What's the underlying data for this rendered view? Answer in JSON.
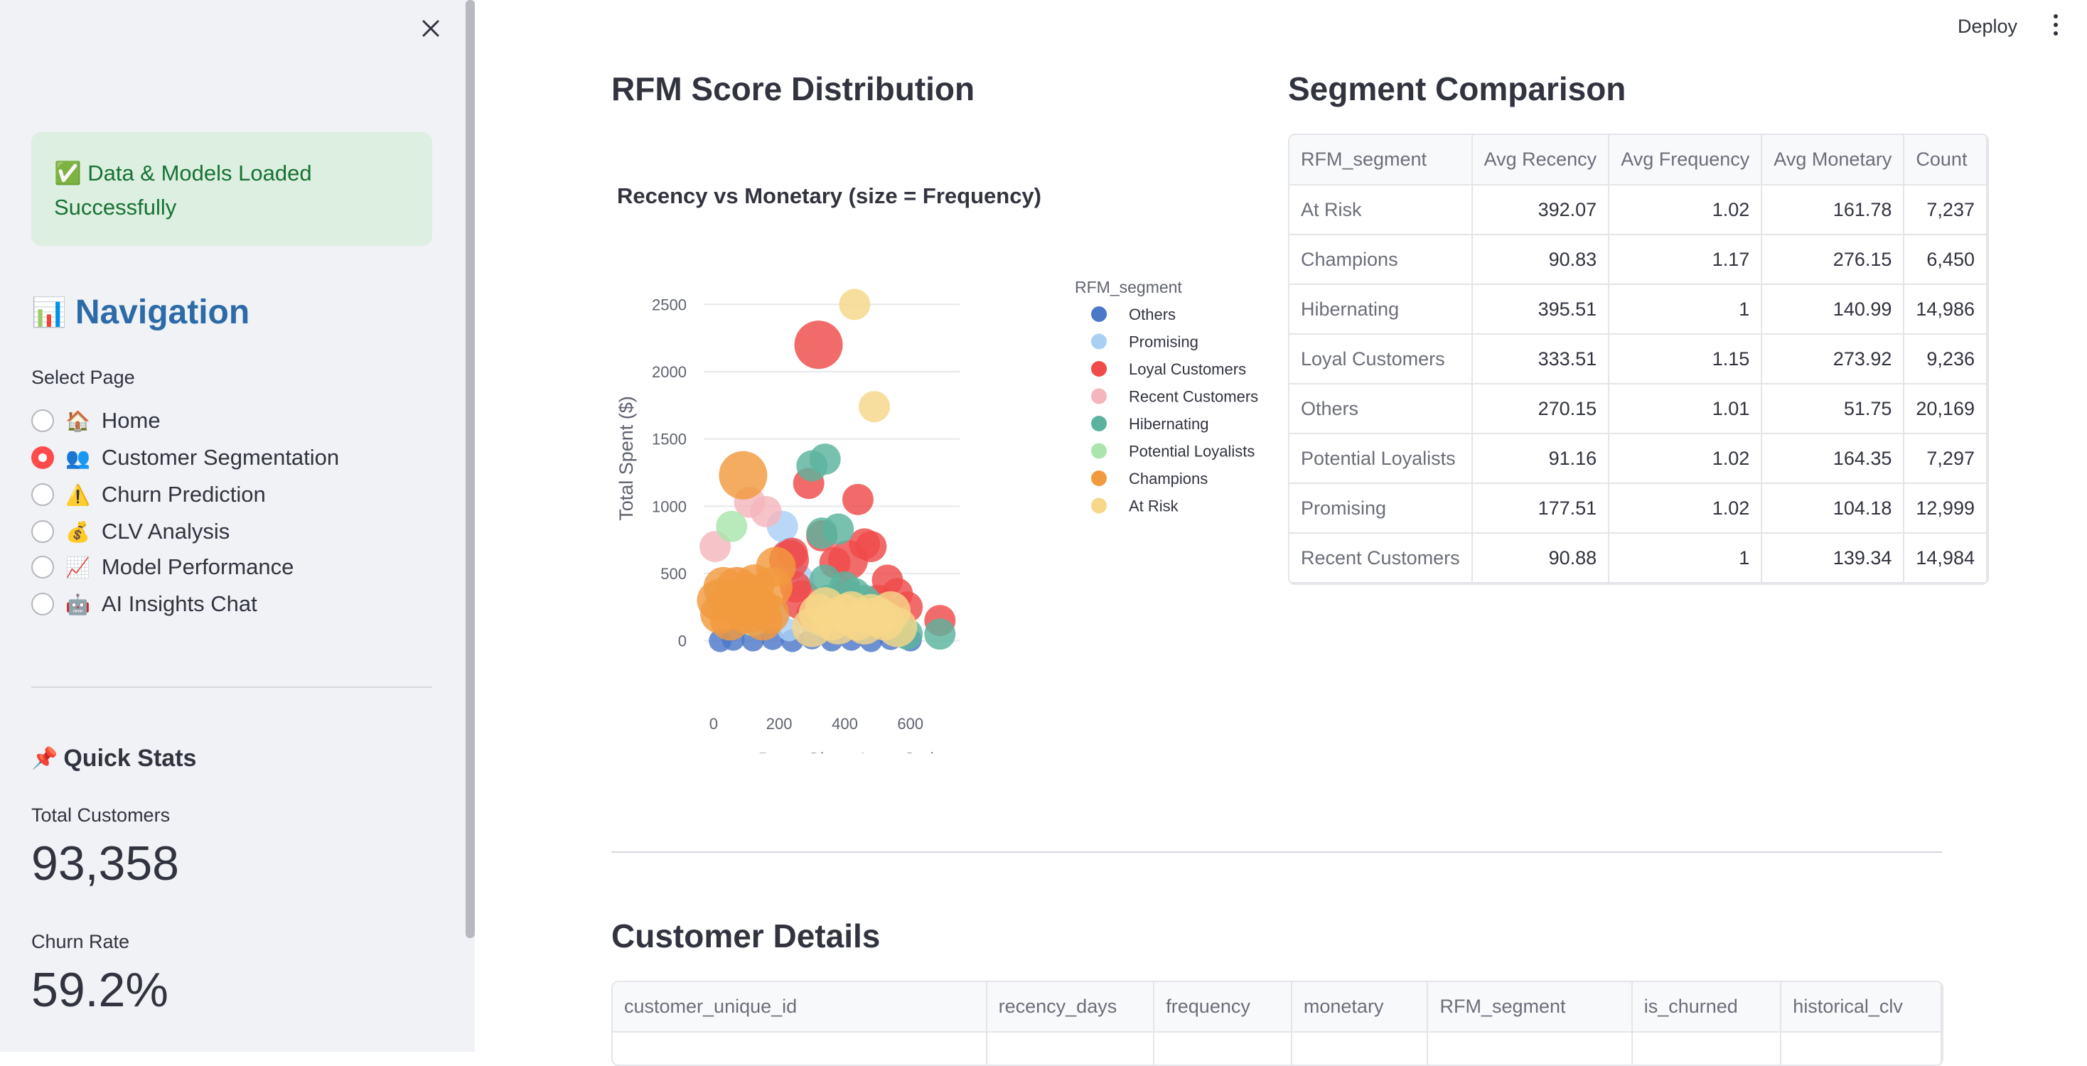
{
  "sidebar": {
    "alert_text": "✅ Data & Models Loaded Successfully",
    "nav_title": "Navigation",
    "select_label": "Select Page",
    "pages": [
      {
        "icon": "🏠",
        "label": "Home",
        "selected": false
      },
      {
        "icon": "👥",
        "label": "Customer Segmentation",
        "selected": true
      },
      {
        "icon": "⚠️",
        "label": "Churn Prediction",
        "selected": false
      },
      {
        "icon": "💰",
        "label": "CLV Analysis",
        "selected": false
      },
      {
        "icon": "📈",
        "label": "Model Performance",
        "selected": false
      },
      {
        "icon": "🤖",
        "label": "AI Insights Chat",
        "selected": false
      }
    ],
    "quick_stats_title": "Quick Stats",
    "metrics": [
      {
        "label": "Total Customers",
        "value": "93,358"
      },
      {
        "label": "Churn Rate",
        "value": "59.2%"
      }
    ]
  },
  "header": {
    "deploy_label": "Deploy"
  },
  "main": {
    "rfm_title": "RFM Score Distribution",
    "segment_title": "Segment Comparison",
    "details_title": "Customer Details"
  },
  "segment_table": {
    "columns": [
      "RFM_segment",
      "Avg Recency",
      "Avg Frequency",
      "Avg Monetary",
      "Count"
    ],
    "rows": [
      [
        "At Risk",
        "392.07",
        "1.02",
        "161.78",
        "7,237"
      ],
      [
        "Champions",
        "90.83",
        "1.17",
        "276.15",
        "6,450"
      ],
      [
        "Hibernating",
        "395.51",
        "1",
        "140.99",
        "14,986"
      ],
      [
        "Loyal Customers",
        "333.51",
        "1.15",
        "273.92",
        "9,236"
      ],
      [
        "Others",
        "270.15",
        "1.01",
        "51.75",
        "20,169"
      ],
      [
        "Potential Loyalists",
        "91.16",
        "1.02",
        "164.35",
        "7,297"
      ],
      [
        "Promising",
        "177.51",
        "1.02",
        "104.18",
        "12,999"
      ],
      [
        "Recent Customers",
        "90.88",
        "1",
        "139.34",
        "14,984"
      ]
    ]
  },
  "details_table": {
    "columns": [
      "customer_unique_id",
      "recency_days",
      "frequency",
      "monetary",
      "RFM_segment",
      "is_churned",
      "historical_clv"
    ]
  },
  "chart_data": {
    "type": "scatter",
    "title": "Recency vs Monetary (size = Frequency)",
    "xlabel": "Days Since Last Order",
    "ylabel": "Total Spent ($)",
    "legend_title": "RFM_segment",
    "legend_position": "right",
    "xlim": [
      -30,
      750
    ],
    "ylim": [
      -150,
      2650
    ],
    "xticks": [
      0,
      200,
      400,
      600
    ],
    "yticks": [
      0,
      500,
      1000,
      1500,
      2000,
      2500
    ],
    "series": [
      {
        "name": "Others",
        "color": "#4c78c8",
        "points": [
          [
            20,
            0,
            1
          ],
          [
            60,
            10,
            1
          ],
          [
            120,
            5,
            1
          ],
          [
            180,
            15,
            1
          ],
          [
            240,
            0,
            1
          ],
          [
            300,
            20,
            1
          ],
          [
            360,
            5,
            1
          ],
          [
            420,
            10,
            1
          ],
          [
            480,
            0,
            1
          ],
          [
            540,
            15,
            1
          ],
          [
            600,
            5,
            1
          ]
        ]
      },
      {
        "name": "Promising",
        "color": "#a9cff5",
        "points": [
          [
            210,
            850,
            2
          ],
          [
            230,
            650,
            2
          ],
          [
            260,
            450,
            2
          ],
          [
            150,
            300,
            1
          ],
          [
            200,
            200,
            1
          ],
          [
            280,
            150,
            1
          ],
          [
            320,
            120,
            1
          ],
          [
            230,
            80,
            1
          ]
        ]
      },
      {
        "name": "Loyal Customers",
        "color": "#ef4b4b",
        "points": [
          [
            320,
            2200,
            4
          ],
          [
            440,
            1050,
            2
          ],
          [
            290,
            1170,
            2
          ],
          [
            370,
            580,
            2
          ],
          [
            410,
            600,
            3
          ],
          [
            460,
            720,
            2
          ],
          [
            230,
            600,
            3
          ],
          [
            250,
            400,
            2
          ],
          [
            270,
            300,
            3
          ],
          [
            300,
            200,
            2
          ],
          [
            350,
            250,
            2
          ],
          [
            400,
            350,
            2
          ],
          [
            500,
            300,
            2
          ],
          [
            530,
            450,
            2
          ],
          [
            560,
            350,
            2
          ],
          [
            590,
            250,
            2
          ],
          [
            690,
            150,
            2
          ],
          [
            240,
            650,
            2
          ],
          [
            330,
            780,
            2
          ],
          [
            480,
            700,
            2
          ]
        ]
      },
      {
        "name": "Recent Customers",
        "color": "#f4b6bc",
        "points": [
          [
            5,
            700,
            2
          ],
          [
            110,
            1030,
            2
          ],
          [
            160,
            960,
            2
          ],
          [
            80,
            430,
            2
          ],
          [
            50,
            350,
            2
          ],
          [
            130,
            300,
            2
          ],
          [
            160,
            200,
            2
          ]
        ]
      },
      {
        "name": "Hibernating",
        "color": "#5bb39e",
        "points": [
          [
            300,
            1300,
            2
          ],
          [
            340,
            1350,
            2
          ],
          [
            330,
            800,
            2
          ],
          [
            380,
            830,
            2
          ],
          [
            340,
            450,
            2
          ],
          [
            400,
            400,
            2
          ],
          [
            430,
            350,
            2
          ],
          [
            460,
            300,
            2
          ],
          [
            500,
            200,
            2
          ],
          [
            530,
            150,
            2
          ],
          [
            560,
            100,
            2
          ],
          [
            590,
            50,
            2
          ],
          [
            690,
            50,
            2
          ],
          [
            350,
            300,
            2
          ],
          [
            420,
            250,
            2
          ],
          [
            480,
            250,
            2
          ]
        ]
      },
      {
        "name": "Potential Loyalists",
        "color": "#a9e5ad",
        "points": [
          [
            55,
            850,
            2
          ],
          [
            20,
            350,
            2
          ],
          [
            40,
            250,
            2
          ],
          [
            80,
            200,
            2
          ],
          [
            120,
            150,
            2
          ],
          [
            160,
            250,
            2
          ]
        ]
      },
      {
        "name": "Champions",
        "color": "#f29a3e",
        "points": [
          [
            90,
            1230,
            4
          ],
          [
            30,
            400,
            3
          ],
          [
            60,
            300,
            3
          ],
          [
            100,
            200,
            3
          ],
          [
            140,
            250,
            3
          ],
          [
            180,
            400,
            3
          ],
          [
            190,
            550,
            3
          ],
          [
            20,
            200,
            3
          ],
          [
            50,
            150,
            3
          ],
          [
            80,
            250,
            3
          ],
          [
            110,
            350,
            3
          ],
          [
            150,
            150,
            3
          ],
          [
            170,
            200,
            3
          ],
          [
            70,
            400,
            3
          ],
          [
            125,
            420,
            3
          ],
          [
            10,
            300,
            3
          ]
        ]
      },
      {
        "name": "At Risk",
        "color": "#f7d789",
        "points": [
          [
            430,
            2500,
            2
          ],
          [
            490,
            1740,
            2
          ],
          [
            320,
            200,
            3
          ],
          [
            360,
            150,
            3
          ],
          [
            400,
            200,
            3
          ],
          [
            440,
            150,
            3
          ],
          [
            480,
            200,
            3
          ],
          [
            520,
            150,
            3
          ],
          [
            560,
            100,
            3
          ],
          [
            300,
            100,
            3
          ],
          [
            340,
            250,
            3
          ],
          [
            380,
            120,
            3
          ],
          [
            420,
            220,
            3
          ],
          [
            460,
            120,
            3
          ],
          [
            500,
            180,
            3
          ],
          [
            540,
            220,
            3
          ]
        ]
      }
    ]
  }
}
